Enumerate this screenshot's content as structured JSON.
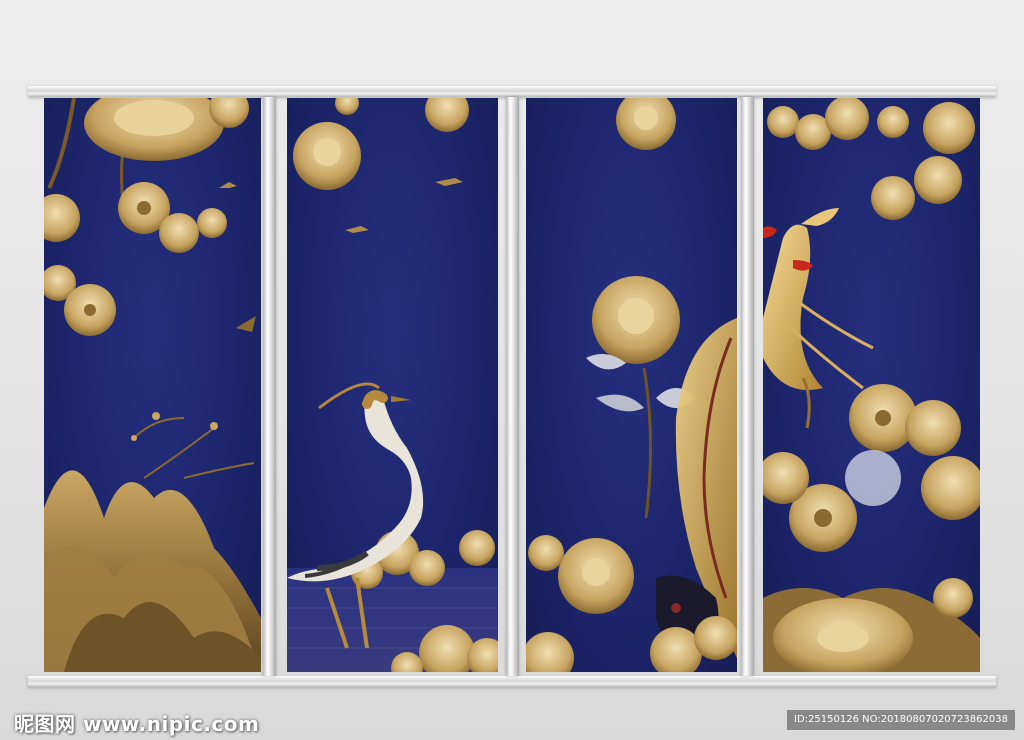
{
  "watermark": {
    "site": "昵图网 www.nipic.com",
    "id_text": "ID:25150126 NO:20180807020723862038"
  },
  "artwork": {
    "panel_count": 4,
    "background_color": "#1f2770",
    "gold_color": "#c9a862",
    "frame_color": "#e6e6e6"
  }
}
